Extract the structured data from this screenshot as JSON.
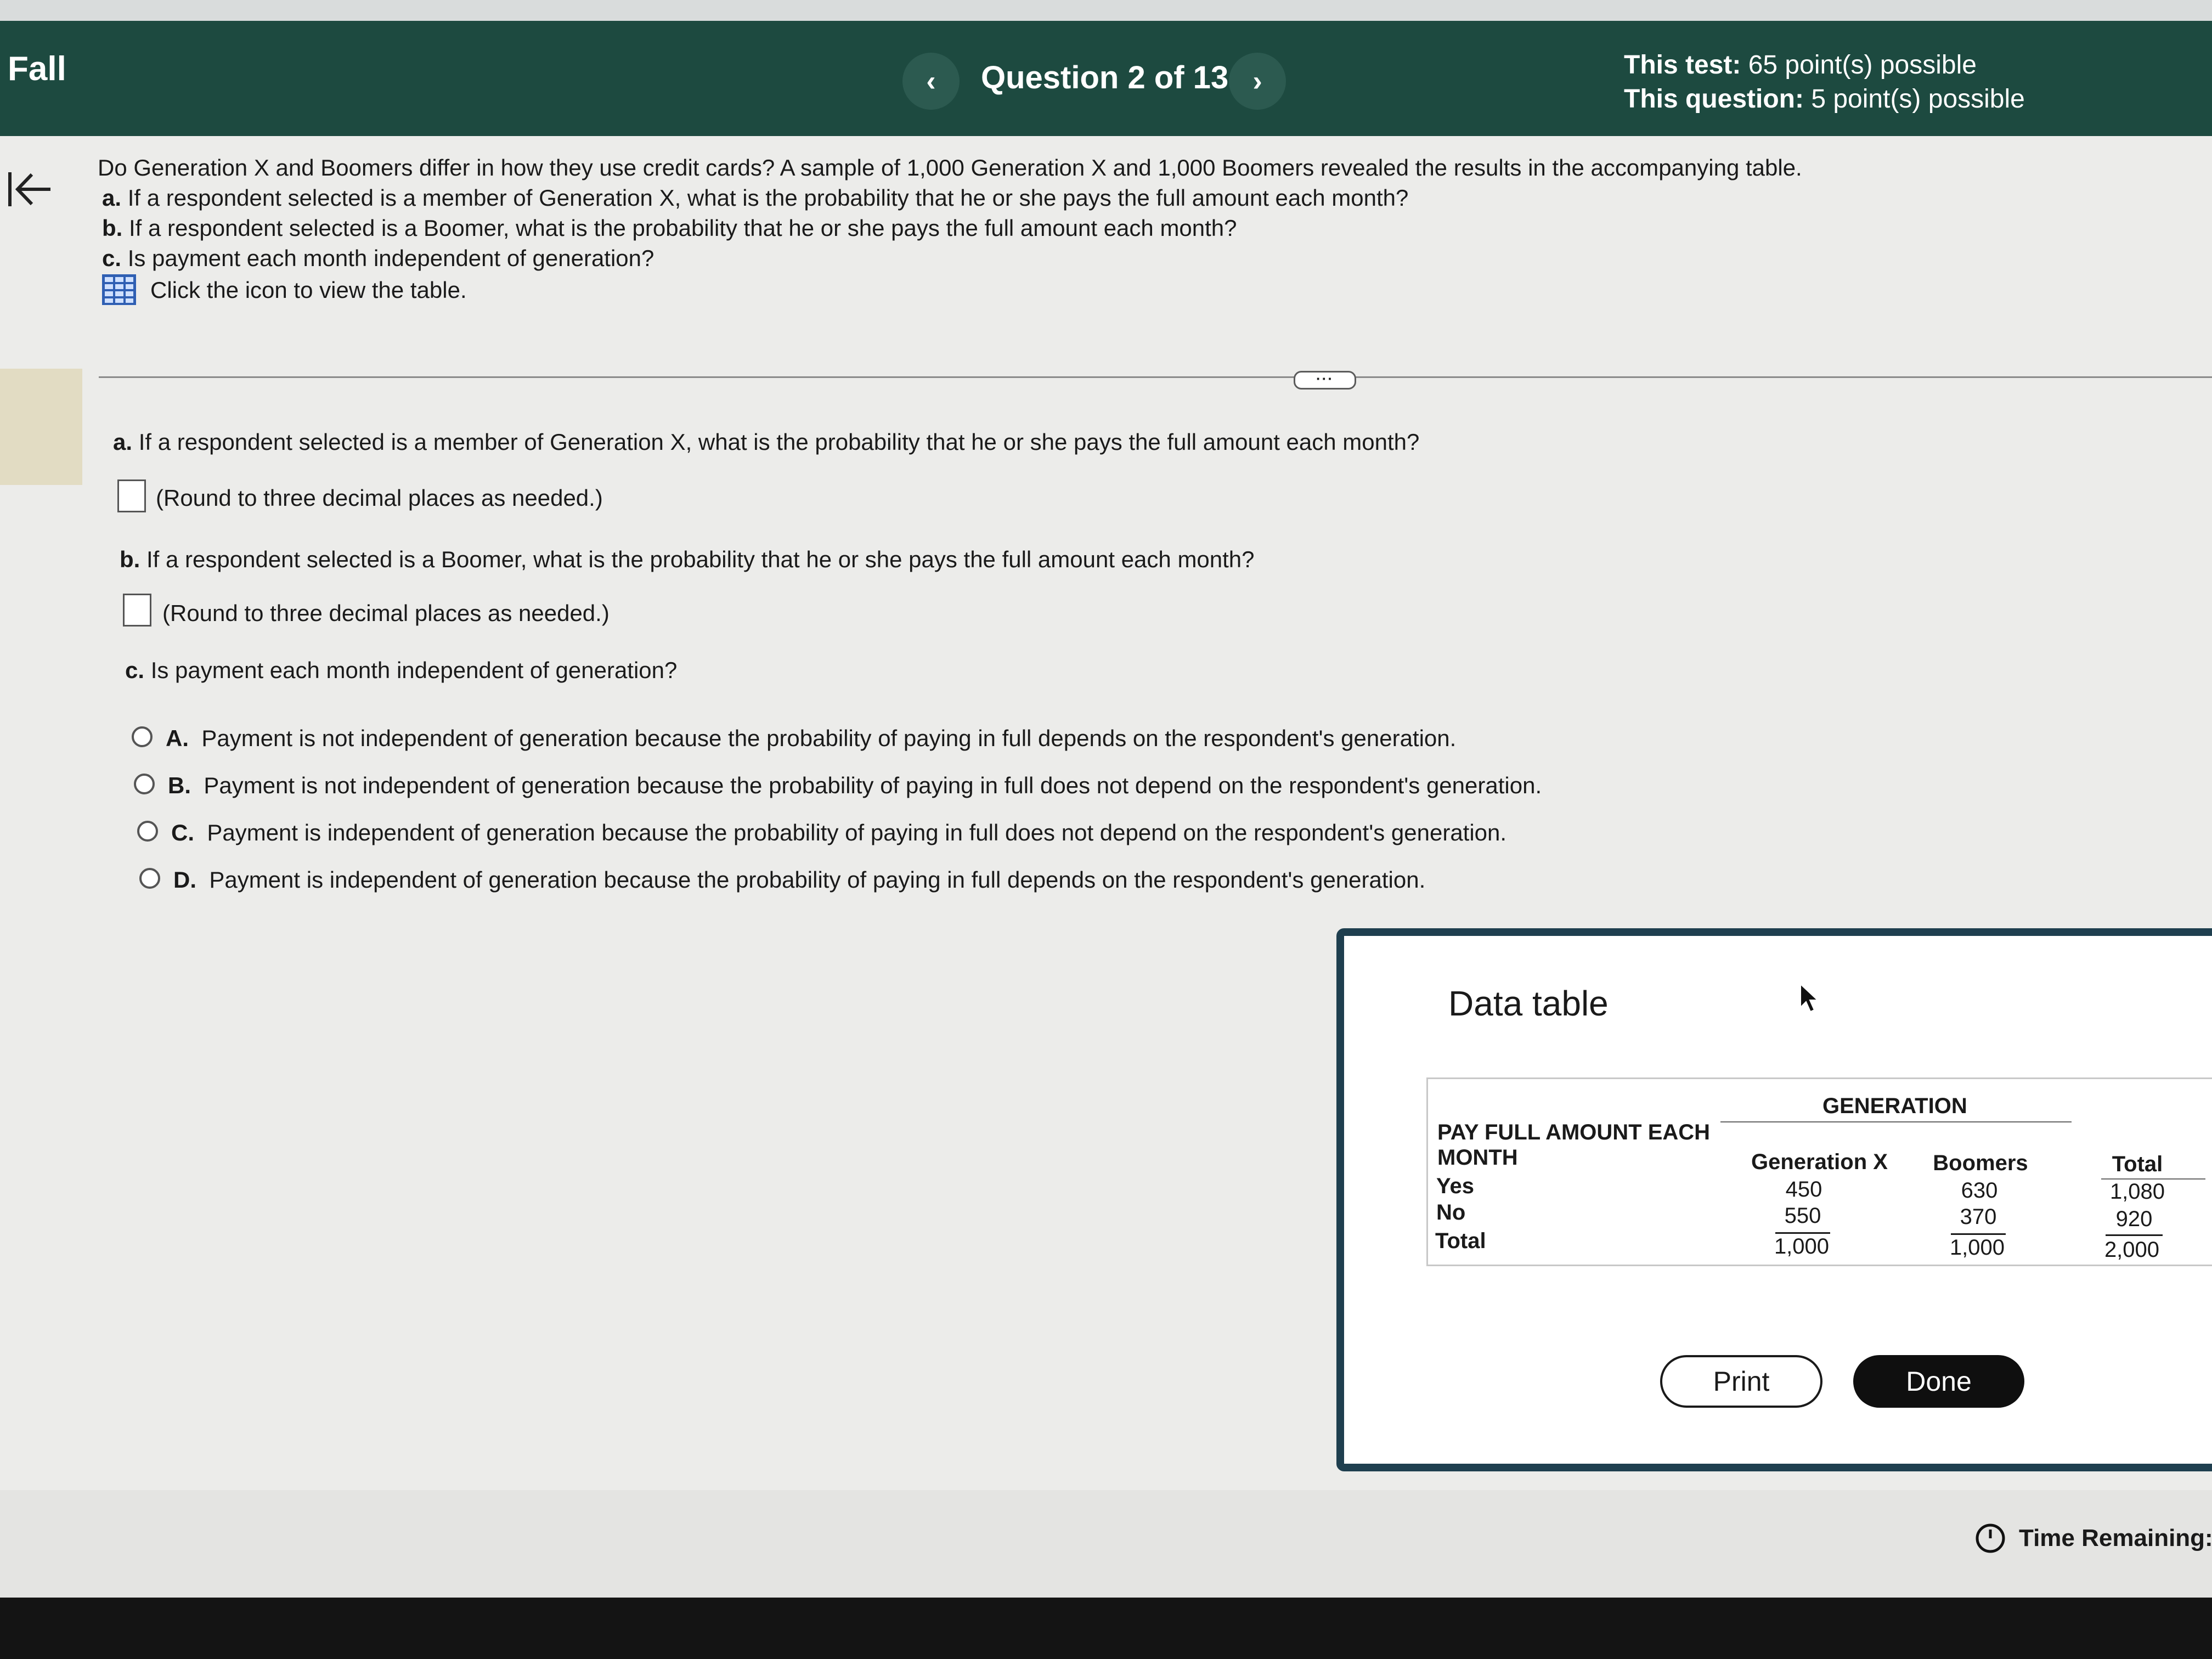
{
  "header": {
    "course": "Fall",
    "question_label": "Question 2 of 13",
    "prev_label": "‹",
    "next_label": "›",
    "test_points_label": "This test:",
    "test_points_value": "65 point(s) possible",
    "question_points_label": "This question:",
    "question_points_value": "5 point(s) possible",
    "bg_color": "#1d4a40"
  },
  "question": {
    "intro": "Do Generation X and Boomers differ in how they use credit cards? A sample of 1,000 Generation X and 1,000 Boomers revealed the results in the accompanying table.",
    "parts": [
      {
        "letter": "a.",
        "text": "If a respondent selected is a member of Generation X, what is the probability that he or she pays the full amount each month?"
      },
      {
        "letter": "b.",
        "text": "If a respondent selected is a Boomer, what is the probability that he or she pays the full amount each month?"
      },
      {
        "letter": "c.",
        "text": "Is payment each month independent of generation?"
      }
    ],
    "table_link": "Click the icon to view the table.",
    "table_icon": "table-grid-icon"
  },
  "answers": {
    "a": {
      "letter": "a.",
      "prompt": "If a respondent selected is a member of Generation X, what is the probability that he or she pays the full amount each month?",
      "value": "",
      "hint": "(Round to three decimal places as needed.)"
    },
    "b": {
      "letter": "b.",
      "prompt": "If a respondent selected is a Boomer, what is the probability that he or she pays the full amount each month?",
      "value": "",
      "hint": "(Round to three decimal places as needed.)"
    },
    "c": {
      "letter": "c.",
      "prompt": "Is payment each month independent of generation?",
      "options": [
        {
          "letter": "A.",
          "text": "Payment is not independent of generation because the probability of paying in full depends on the respondent's generation."
        },
        {
          "letter": "B.",
          "text": "Payment is not independent of generation because the probability of paying in full does not depend on the respondent's generation."
        },
        {
          "letter": "C.",
          "text": "Payment is independent of generation because the probability of paying in full does not depend on the respondent's generation."
        },
        {
          "letter": "D.",
          "text": "Payment is independent of generation because the probability of paying in full depends on the respondent's generation."
        }
      ]
    }
  },
  "modal": {
    "title": "Data table",
    "table": {
      "group_header": "GENERATION",
      "row_header_line1": "PAY FULL AMOUNT EACH",
      "row_header_line2": "MONTH",
      "columns": [
        "Generation X",
        "Boomers",
        "Total"
      ],
      "rows": [
        {
          "label": "Yes",
          "values": [
            "450",
            "630",
            "1,080"
          ]
        },
        {
          "label": "No",
          "values": [
            "550",
            "370",
            "920"
          ]
        },
        {
          "label": "Total",
          "values": [
            "1,000",
            "1,000",
            "2,000"
          ]
        }
      ]
    },
    "print_label": "Print",
    "done_label": "Done"
  },
  "footer": {
    "time_label": "Time Remaining:",
    "clock_icon": "clock-icon"
  }
}
